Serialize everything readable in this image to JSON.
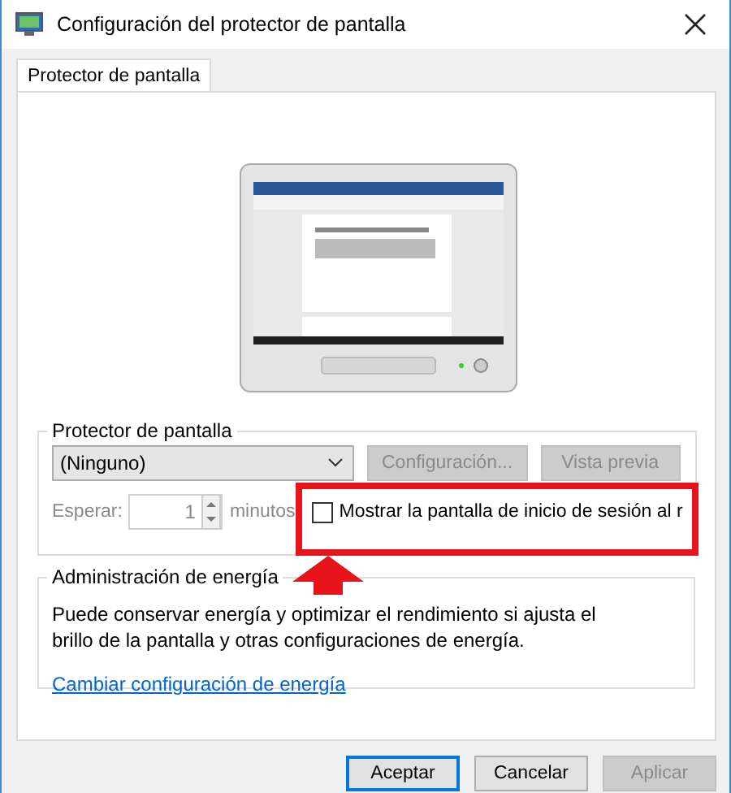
{
  "window": {
    "title": "Configuración del protector de pantalla"
  },
  "tabs": [
    {
      "label": "Protector de pantalla",
      "selected": true
    }
  ],
  "screensaver": {
    "legend": "Protector de pantalla",
    "dropdown": {
      "value": "(Ninguno)"
    },
    "buttons": [
      {
        "label": "Configuración...",
        "disabled": true
      },
      {
        "label": "Vista previa",
        "disabled": true
      }
    ],
    "wait": {
      "label": "Esperar:",
      "value": "1",
      "unit": "minutos",
      "disabled": true
    },
    "logon_checkbox": {
      "label": "Mostrar la pantalla de inicio de sesión al r",
      "checked": false
    }
  },
  "power": {
    "legend": "Administración de energía",
    "description": "Puede conservar energía y optimizar el rendimiento si ajusta el brillo de la pantalla y otras configuraciones de energía.",
    "link": "Cambiar configuración de energía"
  },
  "buttons": [
    {
      "label": "Aceptar",
      "default": true,
      "disabled": false
    },
    {
      "label": "Cancelar",
      "default": false,
      "disabled": false
    },
    {
      "label": "Aplicar",
      "default": false,
      "disabled": true
    }
  ]
}
